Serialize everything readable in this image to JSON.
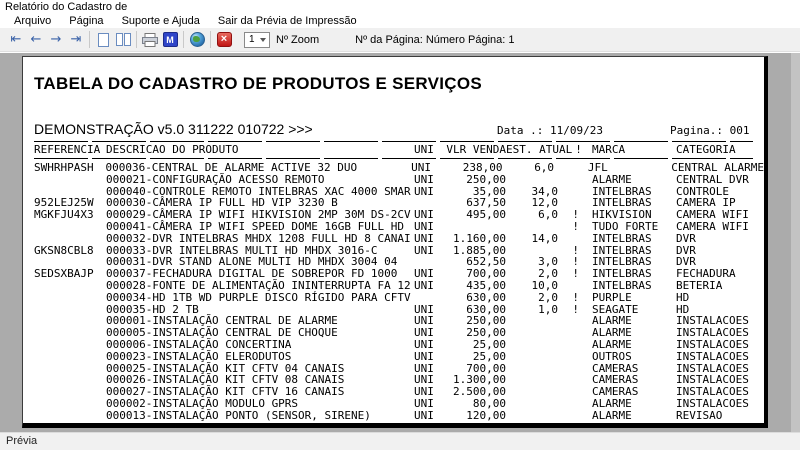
{
  "window": {
    "title": "Relatório do Cadastro de"
  },
  "menu": {
    "items": [
      "Arquivo",
      "Página",
      "Suporte e Ajuda",
      "Sair da Prévia de Impressão"
    ]
  },
  "toolbar": {
    "icons": {
      "first": "⇤",
      "prev": "←",
      "next": "→",
      "last": "⇥",
      "preview_glyph": "M",
      "stop_glyph": "×"
    },
    "zoom_value": "1",
    "zoom_label": "Nº Zoom",
    "page_info": "Nº da Página: Número Página: 1"
  },
  "report": {
    "title": "TABELA DO CADASTRO DE PRODUTOS E SERVIÇOS",
    "subtitle": "DEMONSTRAÇÃO v5.0 311222 010722 >>>",
    "date": "Data .: 11/09/23",
    "page": "Pagina.: 001",
    "columns": {
      "ref": "REFERENCIA",
      "desc": "DESCRICAO DO PRODUTO",
      "uni": "UNI",
      "price": "VLR VENDA",
      "est": "EST. ATUAL",
      "excl": "!",
      "marca": "MARCA",
      "cat": "CATEGORIA"
    },
    "rows": [
      {
        "ref": "SWHRHPASH",
        "desc": "000036-CENTRAL DE ALARME ACTIVE 32 DUO",
        "uni": "UNI",
        "price": "238,00",
        "est": "6,0",
        "excl": "",
        "marca": "JFL",
        "cat": "CENTRAL ALARME"
      },
      {
        "ref": "",
        "desc": "000021-CONFIGURAÇÃO ACESSO REMOTO",
        "uni": "UNI",
        "price": "250,00",
        "est": "",
        "excl": "",
        "marca": "ALARME",
        "cat": "CENTRAL DVR"
      },
      {
        "ref": "",
        "desc": "000040-CONTROLE REMOTO INTELBRAS XAC 4000 SMAR",
        "uni": "UNI",
        "price": "35,00",
        "est": "34,0",
        "excl": "",
        "marca": "INTELBRAS",
        "cat": "CONTROLE"
      },
      {
        "ref": "952LEJ25W",
        "desc": "000030-CÂMERA IP FULL HD VIP 3230 B",
        "uni": "",
        "price": "637,50",
        "est": "12,0",
        "excl": "",
        "marca": "INTELBRAS",
        "cat": "CAMERA IP"
      },
      {
        "ref": "MGKFJU4X3",
        "desc": "000029-CÂMERA IP WIFI HIKVISION 2MP 30M DS-2CV",
        "uni": "UNI",
        "price": "495,00",
        "est": "6,0",
        "excl": "!",
        "marca": "HIKVISION",
        "cat": "CAMERA WIFI"
      },
      {
        "ref": "",
        "desc": "000041-CÂMERA IP WIFI SPEED DOME 16GB FULL HD",
        "uni": "UNI",
        "price": "",
        "est": "",
        "excl": "!",
        "marca": "TUDO FORTE",
        "cat": "CAMERA WIFI"
      },
      {
        "ref": "",
        "desc": "000032-DVR INTELBRAS MHDX 1208 FULL HD 8 CANAI",
        "uni": "UNI",
        "price": "1.160,00",
        "est": "14,0",
        "excl": "",
        "marca": "INTELBRAS",
        "cat": "DVR"
      },
      {
        "ref": "GKSN8CBL8",
        "desc": "000033-DVR INTELBRAS MULTI HD MHDX 3016-C",
        "uni": "UNI",
        "price": "1.885,00",
        "est": "",
        "excl": "!",
        "marca": "INTELBRAS",
        "cat": "DVR"
      },
      {
        "ref": "",
        "desc": "000031-DVR STAND ALONE MULTI HD MHDX 3004 04",
        "uni": "",
        "price": "652,50",
        "est": "3,0",
        "excl": "!",
        "marca": "INTELBRAS",
        "cat": "DVR"
      },
      {
        "ref": "SEDSXBAJP",
        "desc": "000037-FECHADURA DIGITAL DE SOBREPOR FD 1000",
        "uni": "UNI",
        "price": "700,00",
        "est": "2,0",
        "excl": "!",
        "marca": "INTELBRAS",
        "cat": "FECHADURA"
      },
      {
        "ref": "",
        "desc": "000028-FONTE DE ALIMENTAÇÃO ININTERRUPTA FA 12",
        "uni": "UNI",
        "price": "435,00",
        "est": "10,0",
        "excl": "",
        "marca": "INTELBRAS",
        "cat": "BETERIA"
      },
      {
        "ref": "",
        "desc": "000034-HD 1TB WD PURPLE DISCO RÍGIDO PARA CFTV",
        "uni": "",
        "price": "630,00",
        "est": "2,0",
        "excl": "!",
        "marca": "PURPLE",
        "cat": "HD"
      },
      {
        "ref": "",
        "desc": "000035-HD 2 TB",
        "uni": "UNI",
        "price": "630,00",
        "est": "1,0",
        "excl": "!",
        "marca": "SEAGATE",
        "cat": "HD"
      },
      {
        "ref": "",
        "desc": "000001-INSTALAÇÃO CENTRAL DE ALARME",
        "uni": "UNI",
        "price": "250,00",
        "est": "",
        "excl": "",
        "marca": "ALARME",
        "cat": "INSTALACOES"
      },
      {
        "ref": "",
        "desc": "000005-INSTALAÇÃO CENTRAL DE CHOQUE",
        "uni": "UNI",
        "price": "250,00",
        "est": "",
        "excl": "",
        "marca": "ALARME",
        "cat": "INSTALACOES"
      },
      {
        "ref": "",
        "desc": "000006-INSTALAÇÃO CONCERTINA",
        "uni": "UNI",
        "price": "25,00",
        "est": "",
        "excl": "",
        "marca": "ALARME",
        "cat": "INSTALACOES"
      },
      {
        "ref": "",
        "desc": "000023-INSTALAÇÃO ELERODUTOS",
        "uni": "UNI",
        "price": "25,00",
        "est": "",
        "excl": "",
        "marca": "OUTROS",
        "cat": "INSTALACOES"
      },
      {
        "ref": "",
        "desc": "000025-INSTALAÇÃO KIT CFTV 04 CANAIS",
        "uni": "UNI",
        "price": "700,00",
        "est": "",
        "excl": "",
        "marca": "CAMERAS",
        "cat": "INSTALACOES"
      },
      {
        "ref": "",
        "desc": "000026-INSTALAÇÃO KIT CFTV 08 CANAIS",
        "uni": "UNI",
        "price": "1.300,00",
        "est": "",
        "excl": "",
        "marca": "CAMERAS",
        "cat": "INSTALACOES"
      },
      {
        "ref": "",
        "desc": "000027-INSTALAÇÃO KIT CFTV 16 CANAIS",
        "uni": "UNI",
        "price": "2.500,00",
        "est": "",
        "excl": "",
        "marca": "CAMERAS",
        "cat": "INSTALACOES"
      },
      {
        "ref": "",
        "desc": "000002-INSTALAÇÃO MODULO GPRS",
        "uni": "UNI",
        "price": "80,00",
        "est": "",
        "excl": "",
        "marca": "ALARME",
        "cat": "INSTALACOES"
      },
      {
        "ref": "",
        "desc": "000013-INSTALAÇÃO PONTO (SENSOR, SIRENE)",
        "uni": "UNI",
        "price": "120,00",
        "est": "",
        "excl": "",
        "marca": "ALARME",
        "cat": "REVISAO"
      }
    ]
  },
  "statusbar": {
    "text": "Prévia"
  }
}
